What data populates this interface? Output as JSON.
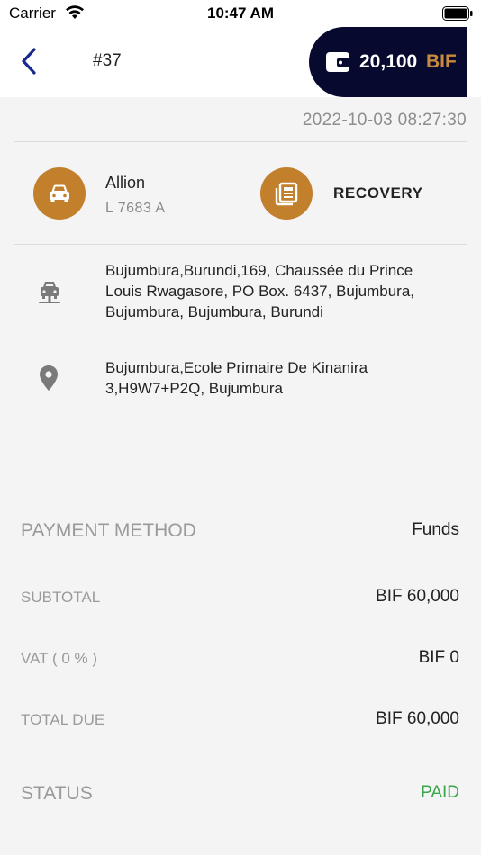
{
  "status_bar": {
    "carrier": "Carrier",
    "time": "10:47 AM"
  },
  "header": {
    "order_number": "#37",
    "wallet_amount": "20,100",
    "wallet_currency": "BIF"
  },
  "order": {
    "datetime": "2022-10-03 08:27:30",
    "vehicle_name": "Allion",
    "plate_number": "L 7683 A",
    "service_type": "RECOVERY",
    "pickup_address": "Bujumbura,Burundi,169, Chaussée du Prince Louis Rwagasore, PO Box. 6437, Bujumbura, Bujumbura, Bujumbura, Burundi",
    "dropoff_address": "Bujumbura,Ecole Primaire De Kinanira 3,H9W7+P2Q, Bujumbura"
  },
  "payment": {
    "method_label": "PAYMENT METHOD",
    "method_value": "Funds",
    "subtotal_label": "SUBTOTAL",
    "subtotal_value": "BIF 60,000",
    "vat_label": "VAT ( 0 % )",
    "vat_value": "BIF 0",
    "total_label": "TOTAL DUE",
    "total_value": "BIF 60,000",
    "status_label": "STATUS",
    "status_value": "PAID"
  },
  "colors": {
    "accent": "#c27f2c",
    "wallet_bg": "#07092e",
    "paid": "#3aa64a",
    "back_arrow": "#1a2a8c"
  },
  "icons": {
    "back": "chevron-left-icon",
    "wallet": "wallet-icon",
    "vehicle": "car-icon",
    "service": "newspaper-icon",
    "pickup": "tow-truck-icon",
    "dropoff": "location-pin-icon"
  }
}
